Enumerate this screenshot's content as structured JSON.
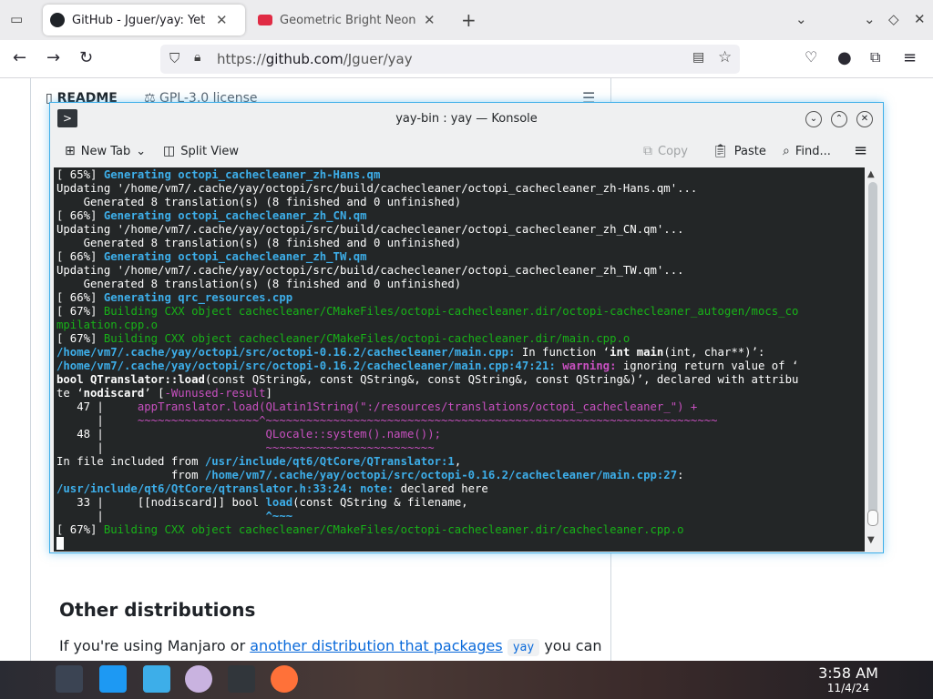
{
  "browser": {
    "tabs": [
      {
        "title": "GitHub - Jguer/yay: Yet another Yogurt",
        "active": true
      },
      {
        "title": "Geometric Bright Neon Triangles",
        "active": false
      }
    ],
    "url_prefix": "https://",
    "url_host": "github.com",
    "url_path": "/Jguer/yay"
  },
  "page": {
    "readme_tab": "README",
    "license_tab": "GPL-3.0 license",
    "heading": "Other distributions",
    "para_pre": "If you're using Manjaro or ",
    "para_link": "another distribution that packages",
    "para_code": "yay",
    "para_post": "you can"
  },
  "konsole": {
    "title": "yay-bin : yay — Konsole",
    "toolbar": {
      "new_tab": "New Tab",
      "split_view": "Split View",
      "copy": "Copy",
      "paste": "Paste",
      "find": "Find..."
    },
    "lines": [
      [
        [
          "[ 65%] ",
          ""
        ],
        [
          "Generating octopi_cachecleaner_zh-Hans.qm",
          "c-blue"
        ]
      ],
      [
        [
          "Updating '/home/vm7/.cache/yay/octopi/src/build/cachecleaner/octopi_cachecleaner_zh-Hans.qm'...",
          ""
        ]
      ],
      [
        [
          "    Generated 8 translation(s) (8 finished and 0 unfinished)",
          ""
        ]
      ],
      [
        [
          "[ 66%] ",
          ""
        ],
        [
          "Generating octopi_cachecleaner_zh_CN.qm",
          "c-blue"
        ]
      ],
      [
        [
          "Updating '/home/vm7/.cache/yay/octopi/src/build/cachecleaner/octopi_cachecleaner_zh_CN.qm'...",
          ""
        ]
      ],
      [
        [
          "    Generated 8 translation(s) (8 finished and 0 unfinished)",
          ""
        ]
      ],
      [
        [
          "[ 66%] ",
          ""
        ],
        [
          "Generating octopi_cachecleaner_zh_TW.qm",
          "c-blue"
        ]
      ],
      [
        [
          "Updating '/home/vm7/.cache/yay/octopi/src/build/cachecleaner/octopi_cachecleaner_zh_TW.qm'...",
          ""
        ]
      ],
      [
        [
          "    Generated 8 translation(s) (8 finished and 0 unfinished)",
          ""
        ]
      ],
      [
        [
          "[ 66%] ",
          ""
        ],
        [
          "Generating qrc_resources.cpp",
          "c-blue"
        ]
      ],
      [
        [
          "[ 67%] ",
          ""
        ],
        [
          "Building CXX object cachecleaner/CMakeFiles/octopi-cachecleaner.dir/octopi-cachecleaner_autogen/mocs_co",
          "c-green"
        ]
      ],
      [
        [
          "mpilation.cpp.o",
          "c-green"
        ]
      ],
      [
        [
          "[ 67%] ",
          ""
        ],
        [
          "Building CXX object cachecleaner/CMakeFiles/octopi-cachecleaner.dir/main.cpp.o",
          "c-green"
        ]
      ],
      [
        [
          "/home/vm7/.cache/yay/octopi/src/octopi-0.16.2/cachecleaner/main.cpp:",
          "c-blue"
        ],
        [
          " In function ‘",
          ""
        ],
        [
          "int main",
          "c-bold"
        ],
        [
          "(int, char**)’:",
          ""
        ]
      ],
      [
        [
          "/home/vm7/.cache/yay/octopi/src/octopi-0.16.2/cachecleaner/main.cpp:47:21:",
          "c-blue"
        ],
        [
          " warning:",
          "c-warn"
        ],
        [
          " ignoring return value of ‘",
          ""
        ]
      ],
      [
        [
          "bool QTranslator::load",
          "c-bold"
        ],
        [
          "(const QString&, const QString&, const QString&, const QString&)’, declared with attribu",
          ""
        ]
      ],
      [
        [
          "te ‘",
          ""
        ],
        [
          "nodiscard",
          "c-bold"
        ],
        [
          "’ [",
          ""
        ],
        [
          "-Wunused-result",
          "c-pink"
        ],
        [
          "]",
          ""
        ]
      ],
      [
        [
          "   47 |   ",
          ""
        ],
        [
          "  appTranslator.load(QLatin1String(\":/resources/translations/octopi_cachecleaner_\") +",
          "c-pink"
        ]
      ],
      [
        [
          "      |     ",
          ""
        ],
        [
          "~~~~~~~~~~~~~~~~~~^~~~~~~~~~~~~~~~~~~~~~~~~~~~~~~~~~~~~~~~~~~~~~~~~~~~~~~~~~~~~~~~~~~~",
          "c-pink"
        ]
      ],
      [
        [
          "   48 |   ",
          ""
        ],
        [
          "                     QLocale::system().name());",
          "c-pink"
        ]
      ],
      [
        [
          "      |   ",
          ""
        ],
        [
          "                     ~~~~~~~~~~~~~~~~~~~~~~~~~",
          "c-pink"
        ]
      ],
      [
        [
          "In file included from ",
          ""
        ],
        [
          "/usr/include/qt6/QtCore/QTranslator:1",
          "c-blue"
        ],
        [
          ",",
          ""
        ]
      ],
      [
        [
          "                 from ",
          ""
        ],
        [
          "/home/vm7/.cache/yay/octopi/src/octopi-0.16.2/cachecleaner/main.cpp:27",
          "c-blue"
        ],
        [
          ":",
          ""
        ]
      ],
      [
        [
          "/usr/include/qt6/QtCore/qtranslator.h:33:24:",
          "c-blue"
        ],
        [
          " note:",
          "c-blue"
        ],
        [
          " declared here",
          ""
        ]
      ],
      [
        [
          "   33 |     [[nodiscard]] bool ",
          ""
        ],
        [
          "load",
          "c-blue"
        ],
        [
          "(const QString & filename,",
          ""
        ]
      ],
      [
        [
          "      |                        ",
          ""
        ],
        [
          "^~~~",
          "c-blue"
        ]
      ],
      [
        [
          "[ 67%] ",
          ""
        ],
        [
          "Building CXX object cachecleaner/CMakeFiles/octopi-cachecleaner.dir/cachecleaner.cpp.o",
          "c-green"
        ]
      ]
    ]
  },
  "taskbar": {
    "time": "3:58 AM",
    "date": "11/4/24"
  }
}
